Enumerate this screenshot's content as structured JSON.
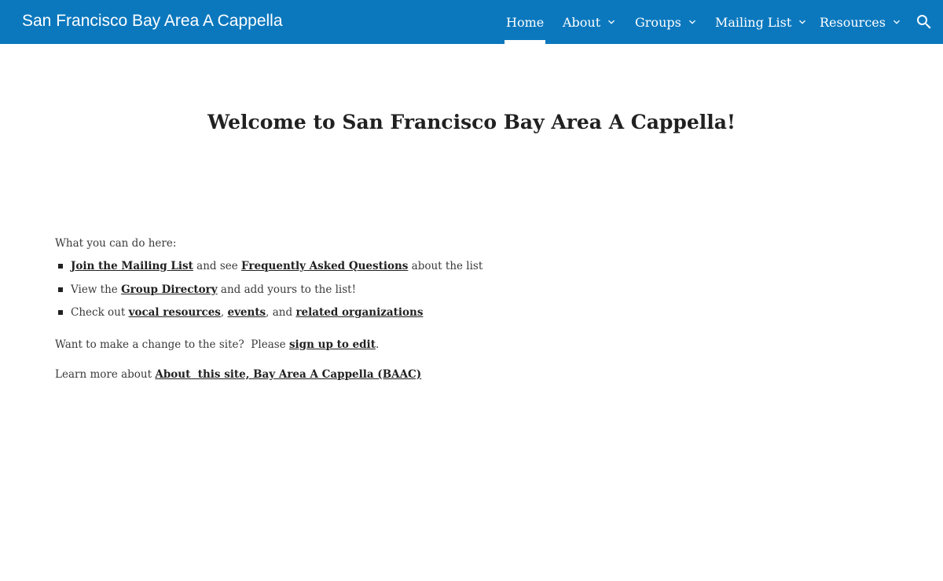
{
  "header": {
    "site_title": "San Francisco Bay Area A Cappella",
    "nav": [
      {
        "label": "Home",
        "active": true,
        "has_dropdown": false
      },
      {
        "label": "About",
        "active": false,
        "has_dropdown": true
      },
      {
        "label": "Groups",
        "active": false,
        "has_dropdown": true
      },
      {
        "label": "Mailing List",
        "active": false,
        "has_dropdown": true
      },
      {
        "label": "Resources",
        "active": false,
        "has_dropdown": true
      }
    ],
    "search_icon": "search-icon",
    "background_color": "#0b78be"
  },
  "main": {
    "title": "Welcome to San Francisco Bay Area A Cappella!",
    "intro": "What you can do here:",
    "bullets": [
      {
        "link1": "Join the Mailing List",
        "text1": " and see ",
        "link2": "Frequently Asked Questions",
        "text2": " about the list"
      },
      {
        "text0": "View the ",
        "link1": "Group Directory",
        "text1": " and add yours to the list!"
      },
      {
        "text0": "Check out ",
        "link1": "vocal resources",
        "text1": ", ",
        "link2": "events",
        "text2": ", and ",
        "link3": "related organizations"
      }
    ],
    "edit_prefix": "Want to make a change to the site?  Please ",
    "edit_link": "sign up to edit",
    "edit_suffix": ".",
    "learn_prefix": "Learn more about ",
    "learn_link": "About  this site, Bay Area A Cappella (BAAC)"
  }
}
